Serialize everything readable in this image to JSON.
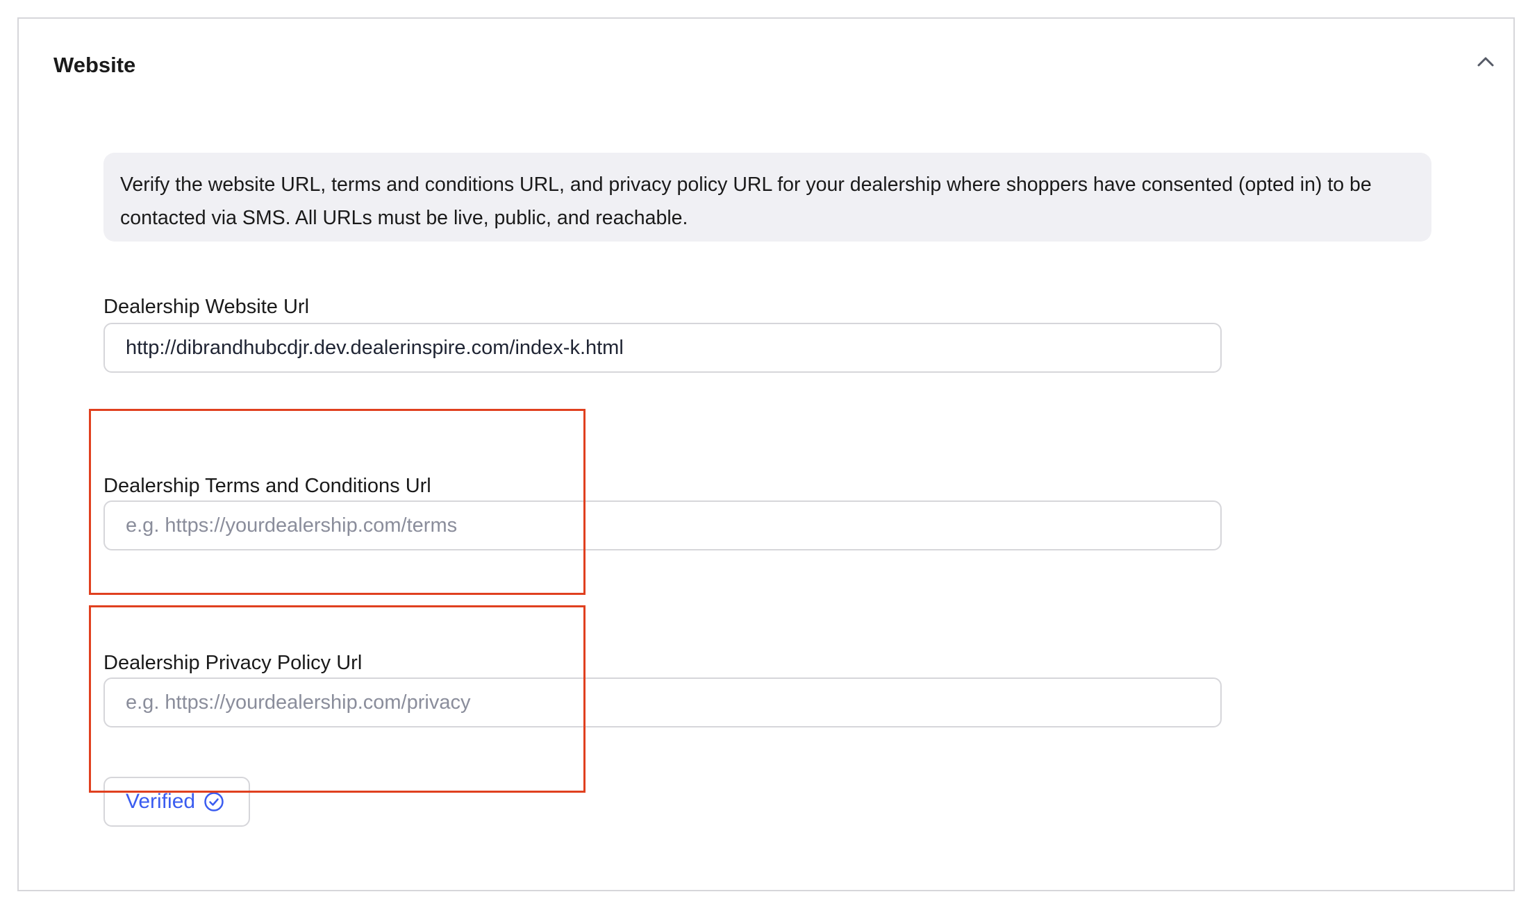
{
  "section": {
    "title": "Website",
    "collapse_icon": "chevron-up-icon"
  },
  "info": {
    "text": "Verify the website URL, terms and conditions URL, and privacy policy URL for your dealership where shoppers have consented (opted in) to be contacted via SMS. All URLs must be live, public, and reachable."
  },
  "fields": {
    "website": {
      "label": "Dealership Website Url",
      "value": "http://dibrandhubcdjr.dev.dealerinspire.com/index-k.html",
      "placeholder": ""
    },
    "terms": {
      "label": "Dealership Terms and Conditions Url",
      "value": "",
      "placeholder": "e.g. https://yourdealership.com/terms"
    },
    "privacy": {
      "label": "Dealership Privacy Policy Url",
      "value": "",
      "placeholder": "e.g. https://yourdealership.com/privacy"
    }
  },
  "verify": {
    "label": "Verified",
    "icon": "check-circle-icon"
  },
  "colors": {
    "accent": "#3a5cf0",
    "highlight": "#e0401f",
    "info_bg": "#f0f0f4",
    "border": "#d6d6da"
  }
}
